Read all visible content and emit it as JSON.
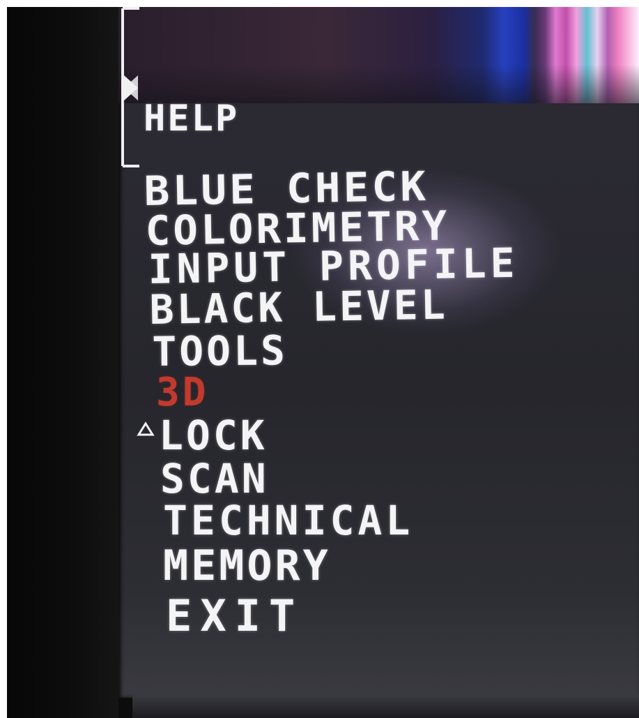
{
  "osd_menu": {
    "header": {
      "help_label": "HELP"
    },
    "items": [
      {
        "label": "BLUE CHECK"
      },
      {
        "label": "COLORIMETRY"
      },
      {
        "label": "INPUT PROFILE"
      },
      {
        "label": "BLACK LEVEL"
      },
      {
        "label": "TOOLS"
      },
      {
        "label": "3D"
      },
      {
        "label": "LOCK"
      },
      {
        "label": "SCAN"
      },
      {
        "label": "TECHNICAL"
      },
      {
        "label": "MEMORY"
      },
      {
        "label": "EXIT"
      }
    ],
    "highlighted_item": "3D",
    "colors": {
      "text": "#f4f4f6",
      "highlight": "#c23a2e",
      "screen_background": "#2a2a30"
    },
    "icons": {
      "selection_marker": "triangle-up-icon",
      "scroll_bracket": "bracket-icon"
    }
  }
}
